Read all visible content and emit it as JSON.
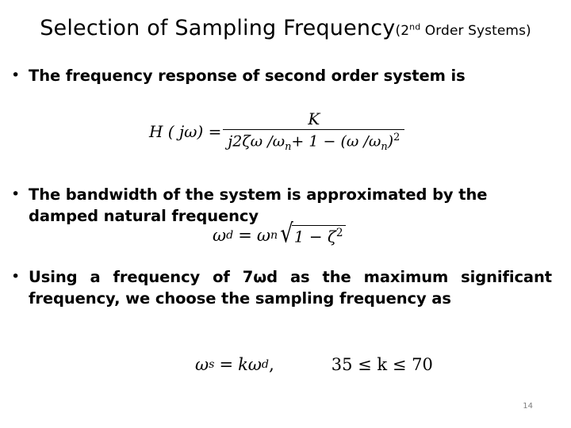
{
  "slide": {
    "title_main": "Selection of Sampling Frequency",
    "title_sub_pre": "(2",
    "title_sub_ord": "nd",
    "title_sub_post": " Order Systems)",
    "page_number": "14"
  },
  "bullets": [
    {
      "marker": "•",
      "text": "The frequency response of second order system is"
    },
    {
      "marker": "•",
      "text": "The bandwidth of the system is approximated by the damped natural frequency"
    },
    {
      "marker": "•",
      "text": "Using a frequency of 7ωd as the maximum significant frequency, we choose the sampling frequency as"
    }
  ],
  "equations": {
    "eq1": {
      "lhs": "H ( jω) =",
      "numerator": "K",
      "denominator_a": "j2ζω /",
      "denominator_sub1": "n",
      "denominator_omega": "ω",
      "denominator_b": "+ 1 − (ω /",
      "denominator_omega2": "ω",
      "denominator_sub2": "n",
      "denominator_c": ")",
      "denominator_pow": "2"
    },
    "eq2": {
      "lhs_omega": "ω",
      "lhs_sub": "d",
      "eq": "=",
      "rhs_omega": "ω",
      "rhs_sub": "n",
      "radicand": "1 − ζ",
      "radicand_pow": "2"
    },
    "eq3": {
      "lhs_omega": "ω",
      "lhs_sub": "s",
      "eq": "=",
      "k": "k",
      "rhs_omega": "ω",
      "rhs_sub": "d",
      "comma": ",",
      "range": "35 ≤ k ≤ 70"
    }
  }
}
